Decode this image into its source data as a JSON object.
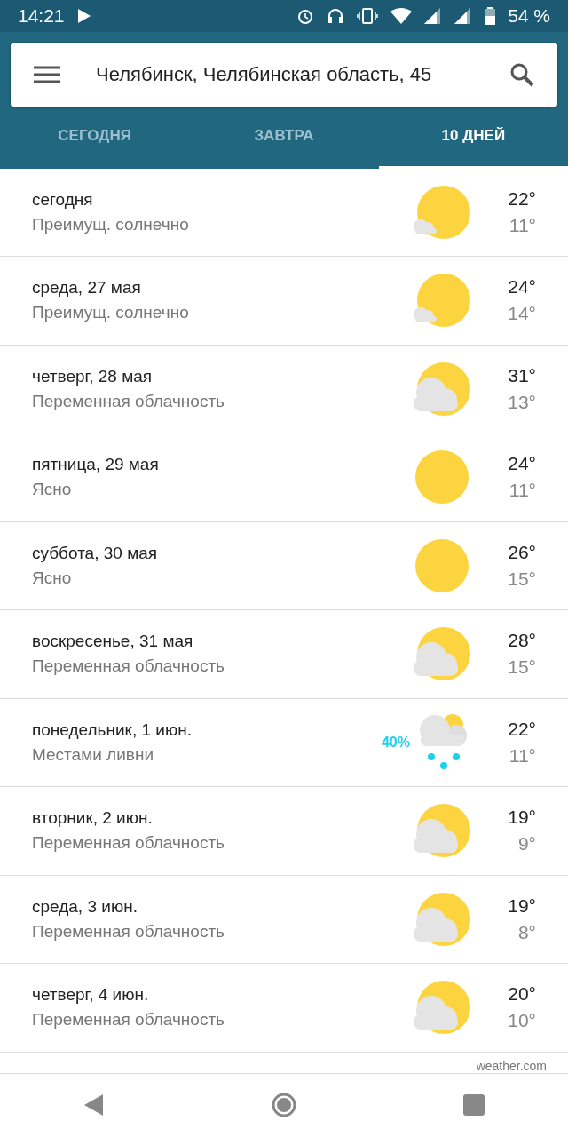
{
  "status_bar": {
    "time": "14:21",
    "battery": "54 %"
  },
  "search": {
    "value": "Челябинск, Челябинская область, 45"
  },
  "tabs": [
    {
      "label": "СЕГОДНЯ",
      "selected": false
    },
    {
      "label": "ЗАВТРА",
      "selected": false
    },
    {
      "label": "10 ДНЕЙ",
      "selected": true
    }
  ],
  "days": [
    {
      "day": "сегодня",
      "condition": "Преимущ. солнечно",
      "kind": "mostly_sunny",
      "high": "22°",
      "low": "11°"
    },
    {
      "day": "среда, 27 мая",
      "condition": "Преимущ. солнечно",
      "kind": "mostly_sunny",
      "high": "24°",
      "low": "14°"
    },
    {
      "day": "четверг, 28 мая",
      "condition": "Переменная облачность",
      "kind": "partly_cloudy",
      "high": "31°",
      "low": "13°"
    },
    {
      "day": "пятница, 29 мая",
      "condition": "Ясно",
      "kind": "clear",
      "high": "24°",
      "low": "11°"
    },
    {
      "day": "суббота, 30 мая",
      "condition": "Ясно",
      "kind": "clear",
      "high": "26°",
      "low": "15°"
    },
    {
      "day": "воскресенье, 31 мая",
      "condition": "Переменная облачность",
      "kind": "partly_cloudy",
      "high": "28°",
      "low": "15°"
    },
    {
      "day": "понедельник, 1 июн.",
      "condition": "Местами ливни",
      "kind": "showers",
      "precip": "40%",
      "high": "22°",
      "low": "11°"
    },
    {
      "day": "вторник, 2 июн.",
      "condition": "Переменная облачность",
      "kind": "partly_cloudy",
      "high": "19°",
      "low": "9°"
    },
    {
      "day": "среда, 3 июн.",
      "condition": "Переменная облачность",
      "kind": "partly_cloudy",
      "high": "19°",
      "low": "8°"
    },
    {
      "day": "четверг, 4 июн.",
      "condition": "Переменная облачность",
      "kind": "partly_cloudy",
      "high": "20°",
      "low": "10°"
    }
  ],
  "source": "weather.com"
}
